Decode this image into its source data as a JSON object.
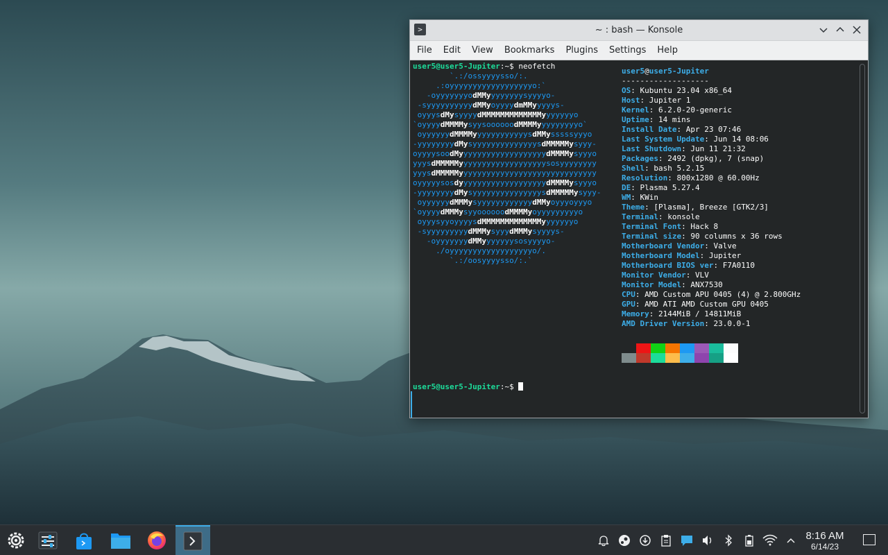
{
  "window": {
    "title": "~ : bash — Konsole",
    "menu": [
      "File",
      "Edit",
      "View",
      "Bookmarks",
      "Plugins",
      "Settings",
      "Help"
    ]
  },
  "terminal": {
    "prompt_user": "user5@user5-Jupiter",
    "prompt_suffix": ":~$ ",
    "command": "neofetch",
    "logo_lines": [
      "        `.:/ossyyyysso/:.",
      "     .:oyyyyyyyyyyyyyyyyyyo:`",
      "   -oyyyyyyyodMMyyyyyyyysyyyyo-",
      " -syyyyyyyyyydMMyoyyyydmMMyyyyys-",
      " oyyysdMysyyyydMMMMMMMMMMMMMyyyyyyyo",
      "`oyyyydMMMMysyysoooooodMMMMyyyyyyyyyo`",
      " oyyyyyydMMMMyyyyyyyyyyyysdMMysssssyyyo",
      "-yyyyyyyydMysyyyyyyyyyyyyyysdMMMMMysyyy-",
      "oyyyysoodMyyyyyyyyyyyyyyyyyyydMMMMysyyyo",
      "yyysdMMMMMyyyyyyyyyyyyyyyyyyysosyyyyyyyy",
      "yyysdMMMMMyyyyyyyyyyyyyyyyyyyyyyyyyyyyyy",
      "oyyyyysosdyyyyyyyyyyyyyyyyyyydMMMMysyyyo",
      "-yyyyyyyydMysyyyyyyyyyyyyyyysdMMMMMysyyy-",
      " oyyyyyydMMMysyyyyyyyyyyyydMMyoyyyoyyyo",
      "`oyyyydMMMysyyoooooodMMMMyoyyyyyyyyyo",
      " oyyysyyoyyyysdMMMMMMMMMMMMMyyyyyyyo",
      " -syyyyyyyyydMMMysyyydMMMysyyyys-",
      "   -oyyyyyyydMMyyyyyyysosyyyyo-",
      "     ./oyyyyyyyyyyyyyyyyyyo/.",
      "        `.:/oosyyyysso/:.`"
    ],
    "info_header_user": "user5",
    "info_header_host": "user5-Jupiter",
    "info_separator": "-------------------",
    "info": [
      {
        "key": "OS",
        "value": "Kubuntu 23.04 x86_64"
      },
      {
        "key": "Host",
        "value": "Jupiter 1"
      },
      {
        "key": "Kernel",
        "value": "6.2.0-20-generic"
      },
      {
        "key": "Uptime",
        "value": "14 mins"
      },
      {
        "key": "Install Date",
        "value": "Apr 23 07:46"
      },
      {
        "key": "Last System Update",
        "value": "Jun 14 08:06"
      },
      {
        "key": "Last Shutdown",
        "value": "Jun 11 21:32"
      },
      {
        "key": "Packages",
        "value": "2492 (dpkg), 7 (snap)"
      },
      {
        "key": "Shell",
        "value": "bash 5.2.15"
      },
      {
        "key": "Resolution",
        "value": "800x1280 @ 60.00Hz"
      },
      {
        "key": "DE",
        "value": "Plasma 5.27.4"
      },
      {
        "key": "WM",
        "value": "KWin"
      },
      {
        "key": "Theme",
        "value": "[Plasma], Breeze [GTK2/3]"
      },
      {
        "key": "Terminal",
        "value": "konsole"
      },
      {
        "key": "Terminal Font",
        "value": "Hack 8"
      },
      {
        "key": "Terminal size",
        "value": "90 columns x 36 rows"
      },
      {
        "key": "Motherboard Vendor",
        "value": "Valve"
      },
      {
        "key": "Motherboard Model",
        "value": "Jupiter"
      },
      {
        "key": "Motherboard BIOS ver",
        "value": "F7A0110"
      },
      {
        "key": "Monitor Vendor",
        "value": "VLV"
      },
      {
        "key": "Monitor Model",
        "value": "ANX7530"
      },
      {
        "key": "CPU",
        "value": "AMD Custom APU 0405 (4) @ 2.800GHz"
      },
      {
        "key": "GPU",
        "value": "AMD ATI AMD Custom GPU 0405"
      },
      {
        "key": "Memory",
        "value": "2144MiB / 14811MiB"
      },
      {
        "key": "AMD Driver Version",
        "value": "23.0.0-1"
      }
    ],
    "palette_top": [
      "#232627",
      "#ed1515",
      "#11d116",
      "#f67400",
      "#1d99f3",
      "#9b59b6",
      "#1abc9c",
      "#fcfcfc"
    ],
    "palette_bottom": [
      "#7f8c8d",
      "#c0392b",
      "#1cdc9a",
      "#fdbc4b",
      "#3daee9",
      "#8e44ad",
      "#16a085",
      "#ffffff"
    ]
  },
  "taskbar": {
    "apps": [
      {
        "name": "app-launcher",
        "icon": "kde-gear-icon"
      },
      {
        "name": "system-settings",
        "icon": "sliders-icon"
      },
      {
        "name": "discover",
        "icon": "shopping-bag-icon"
      },
      {
        "name": "dolphin",
        "icon": "folder-icon"
      },
      {
        "name": "firefox",
        "icon": "firefox-icon"
      },
      {
        "name": "konsole",
        "icon": "terminal-icon"
      }
    ],
    "tray": [
      "notification-bell-icon",
      "steam-icon",
      "update-icon",
      "clipboard-icon",
      "chat-icon",
      "volume-icon",
      "bluetooth-icon",
      "battery-icon",
      "wifi-icon",
      "chevron-up-icon"
    ],
    "time": "8:16 AM",
    "date": "6/14/23"
  }
}
